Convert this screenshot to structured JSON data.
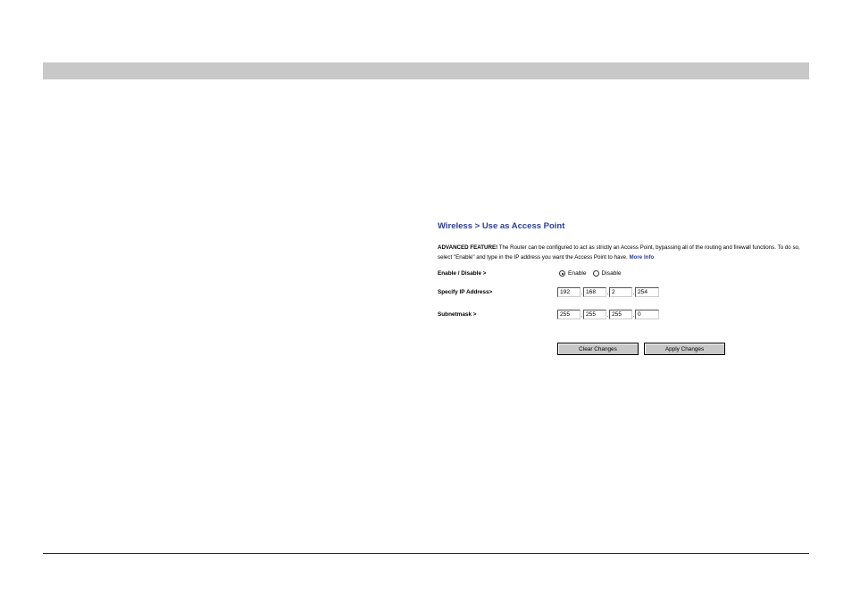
{
  "panel": {
    "title": "Wireless > Use as Access Point",
    "description": {
      "label": "ADVANCED FEATURE!",
      "text": " The Router can be configured to act as strictly an Access Point, bypassing all of the routing and firewall functions. To do so, select \"Enable\" and type in the IP address you want the Access Point to have. ",
      "more_info": "More Info"
    },
    "enable_disable": {
      "label": "Enable / Disable >",
      "options": [
        {
          "label": "Enable",
          "selected": true
        },
        {
          "label": "Disable",
          "selected": false
        }
      ]
    },
    "ip_address": {
      "label": "Specify IP Address>",
      "octets": [
        "192",
        "168",
        "2",
        "254"
      ],
      "separator": "."
    },
    "subnet_mask": {
      "label": "Subnetmask >",
      "octets": [
        "255",
        "255",
        "255",
        "0"
      ],
      "separator": "."
    },
    "buttons": {
      "clear": "Clear Changes",
      "apply": "Apply Changes"
    }
  },
  "colors": {
    "title": "#2c3f94",
    "top_bar": "#c8c8c8",
    "button_face": "#c8c8c8"
  }
}
